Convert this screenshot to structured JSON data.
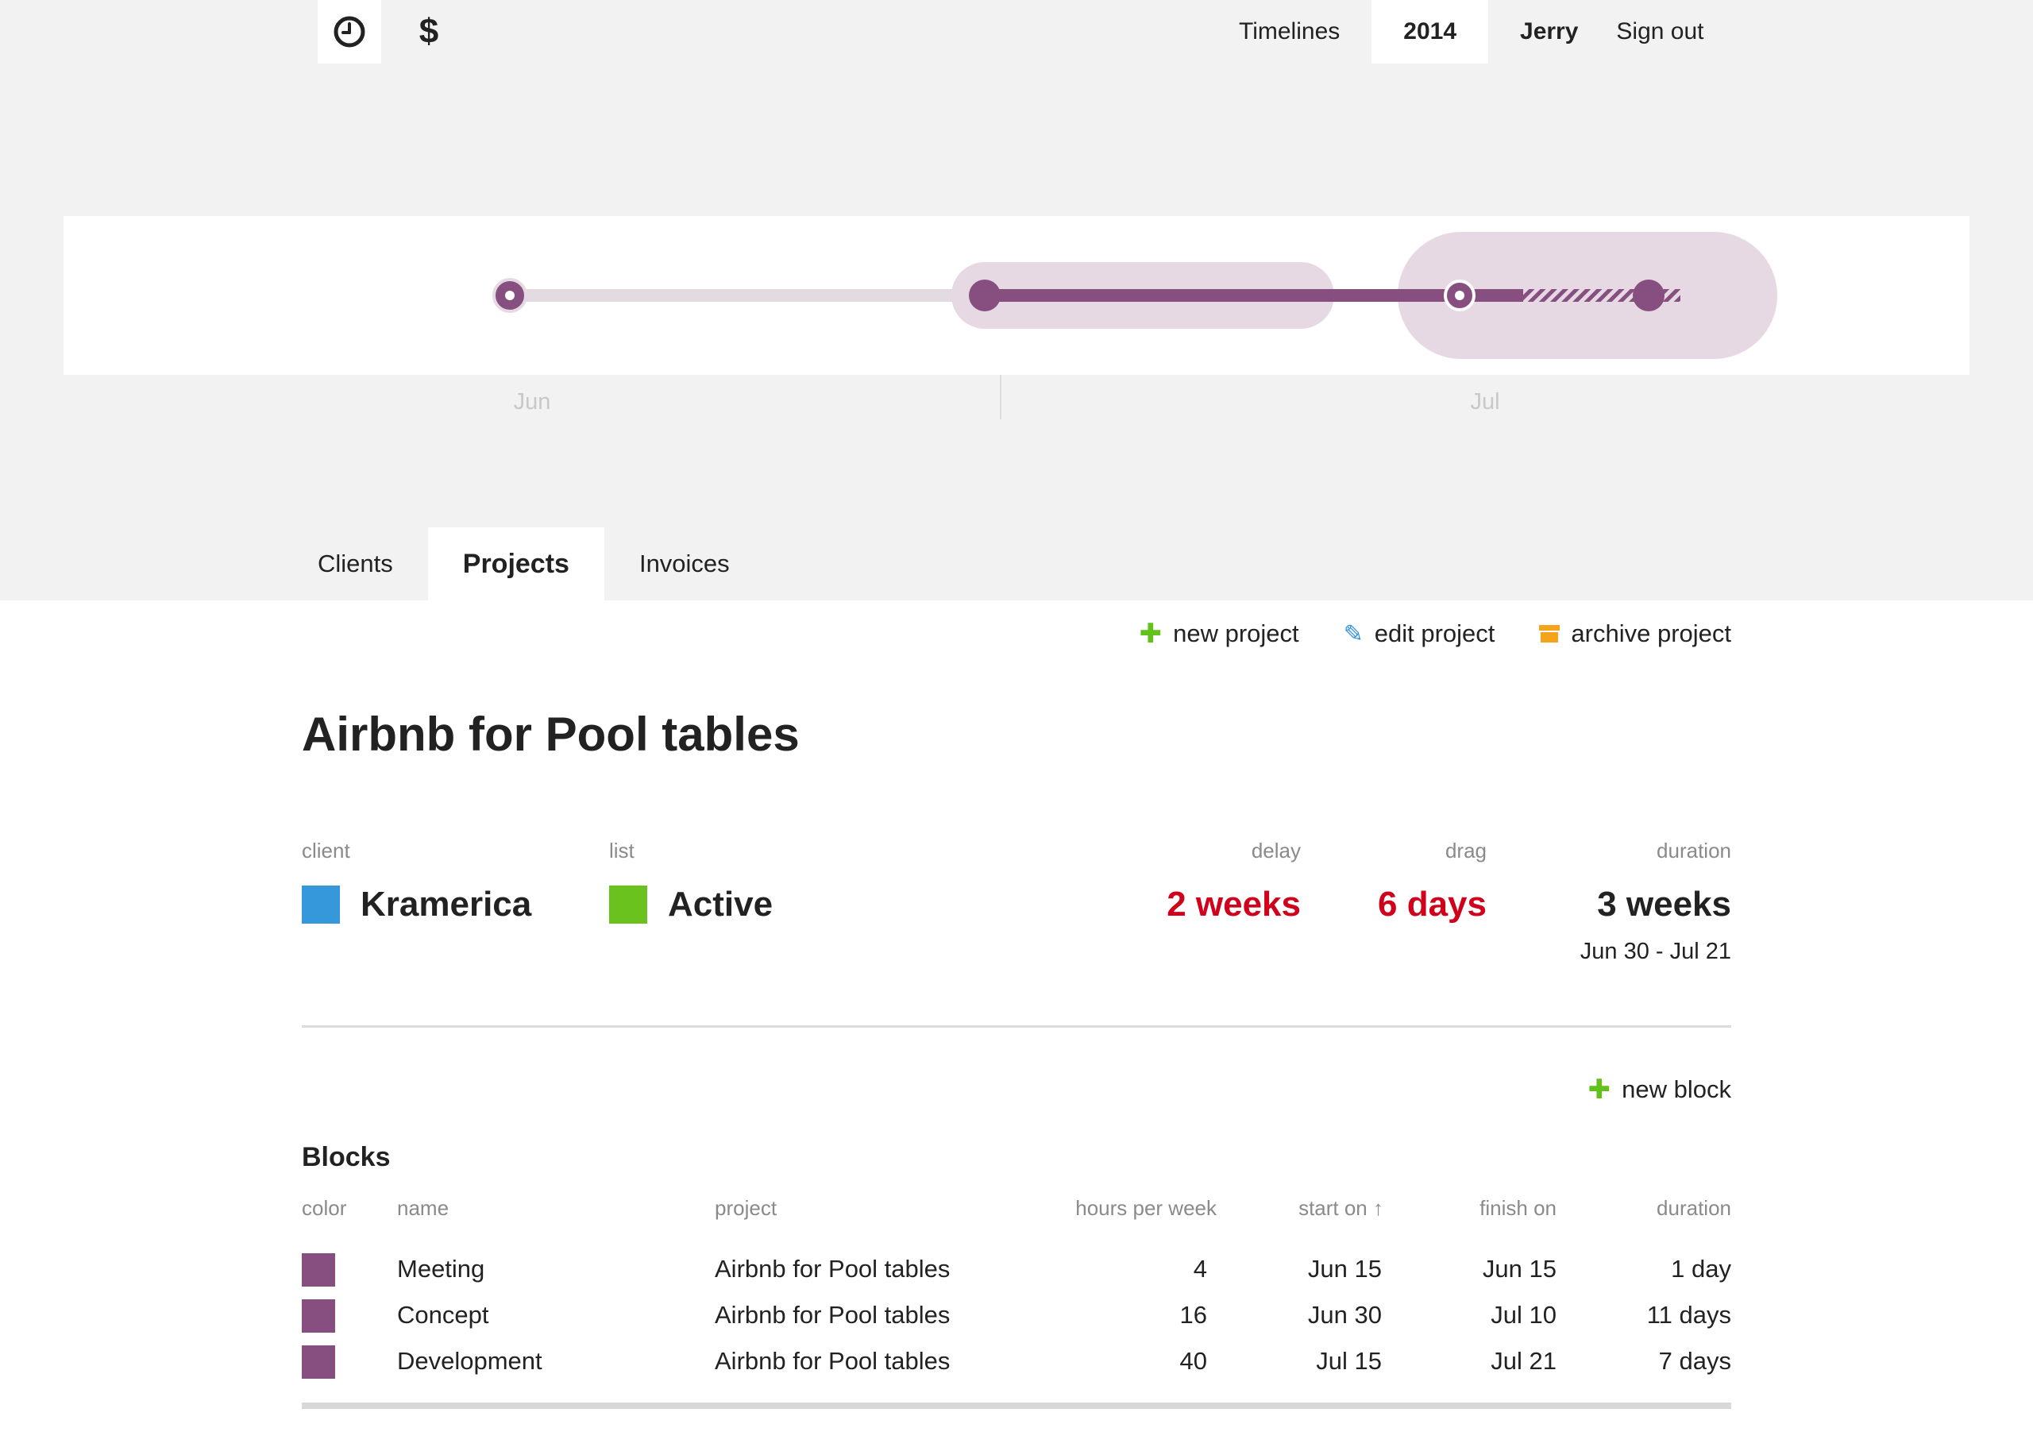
{
  "header": {
    "nav": {
      "timelines": "Timelines",
      "year": "2014",
      "user": "Jerry",
      "signout": "Sign out"
    },
    "icons": {
      "clock": "clock-icon",
      "money": "$"
    }
  },
  "timeline": {
    "months": [
      "Jun",
      "Jul"
    ],
    "colors": {
      "accent": "#874f80",
      "light": "#e6d9e4",
      "track": "#e3dbe2"
    }
  },
  "tabs": [
    "Clients",
    "Projects",
    "Invoices"
  ],
  "actions": {
    "new_project": "new project",
    "edit_project": "edit project",
    "archive_project": "archive project"
  },
  "project": {
    "title": "Airbnb for Pool tables",
    "labels": {
      "client": "client",
      "list": "list",
      "delay": "delay",
      "drag": "drag",
      "duration": "duration"
    },
    "client": {
      "name": "Kramerica",
      "color": "#3498db"
    },
    "list": {
      "name": "Active",
      "color": "#6ac21f"
    },
    "delay": "2 weeks",
    "drag": "6 days",
    "duration": "3 weeks",
    "dates": "Jun 30 - Jul 21"
  },
  "blocks": {
    "new_block": "new block",
    "title": "Blocks",
    "columns": [
      "color",
      "name",
      "project",
      "hours per week",
      "start on ↑",
      "finish on",
      "duration"
    ],
    "rows": [
      {
        "color": "#874f80",
        "name": "Meeting",
        "project": "Airbnb for Pool tables",
        "hours": "4",
        "start": "Jun 15",
        "finish": "Jun 15",
        "duration": "1 day"
      },
      {
        "color": "#874f80",
        "name": "Concept",
        "project": "Airbnb for Pool tables",
        "hours": "16",
        "start": "Jun 30",
        "finish": "Jul 10",
        "duration": "11 days"
      },
      {
        "color": "#874f80",
        "name": "Development",
        "project": "Airbnb for Pool tables",
        "hours": "40",
        "start": "Jul 15",
        "finish": "Jul 21",
        "duration": "7 days"
      }
    ]
  }
}
